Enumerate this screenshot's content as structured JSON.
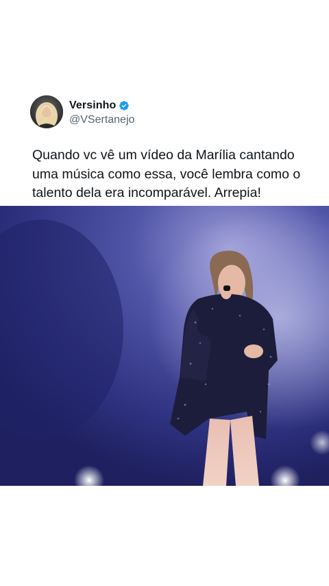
{
  "tweet": {
    "author": {
      "display_name": "Versinho",
      "handle": "@VSertanejo",
      "verified": true,
      "avatar": "avatar-image"
    },
    "text": "Quando vc vê um vídeo da Marília cantando uma música como essa, você lembra como o talento dela era incomparável. Arrepia!",
    "media": {
      "type": "video-frame",
      "content": "singer-on-stage"
    }
  },
  "colors": {
    "background": "#ffffff",
    "text_primary": "#0f1419",
    "text_secondary": "#536471",
    "verified_blue": "#1d9bf0",
    "stage_purple": "#3a3f8f"
  }
}
